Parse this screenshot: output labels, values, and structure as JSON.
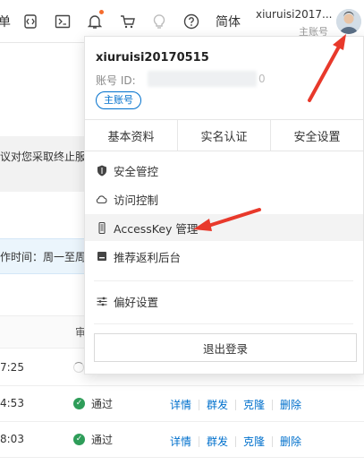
{
  "header": {
    "left_glyph": "单",
    "lang_label": "简体",
    "account_name": "xiuruisi2017...",
    "account_type": "主账号",
    "icons": [
      "code-repo-icon",
      "terminal-icon",
      "bell-icon",
      "cart-icon",
      "lightbulb-icon",
      "help-icon"
    ]
  },
  "background": {
    "notice_text": "议对您采取终止服",
    "info_text": "作时间：周一至周",
    "table_header_partial": "审",
    "rows": [
      {
        "time": "7:25",
        "status": "",
        "loading": true
      },
      {
        "time": "4:53",
        "status": "通过"
      },
      {
        "time": "8:03",
        "status": "通过"
      }
    ],
    "row_actions": [
      "详情",
      "群发",
      "克隆",
      "删除"
    ]
  },
  "dropdown": {
    "username": "xiuruisi20170515",
    "account_id_label": "账号 ID:",
    "account_id_tail": "0",
    "account_tag": "主账号",
    "tabs": [
      "基本资料",
      "实名认证",
      "安全设置"
    ],
    "menu": [
      {
        "label": "安全管控",
        "icon": "shield-icon"
      },
      {
        "label": "访问控制",
        "icon": "cloud-icon"
      },
      {
        "label": "AccessKey 管理",
        "icon": "key-icon",
        "highlighted": true
      },
      {
        "label": "推荐返利后台",
        "icon": "gift-icon"
      }
    ],
    "preferences_label": "偏好设置",
    "logout_label": "退出登录"
  },
  "colors": {
    "link": "#0070cc",
    "success": "#2e9d59",
    "annotation_arrow": "#e8392b"
  }
}
